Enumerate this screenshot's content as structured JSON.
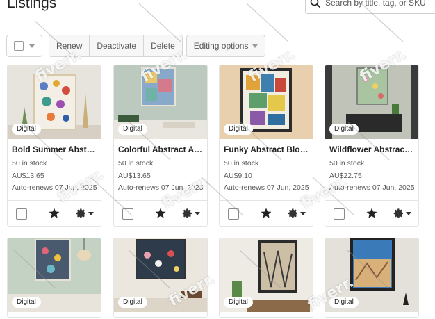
{
  "header": {
    "title": "Listings",
    "search_placeholder": "Search by title, tag, or SKU"
  },
  "toolbar": {
    "renew_label": "Renew",
    "deactivate_label": "Deactivate",
    "delete_label": "Delete",
    "editing_label": "Editing options"
  },
  "listings": [
    {
      "badge": "Digital",
      "title": "Bold Summer Abstract Art",
      "stock": "50 in stock",
      "price": "AU$13.65",
      "renews": "Auto-renews 07 Jun, 2025"
    },
    {
      "badge": "Digital",
      "title": "Colorful Abstract Art Print",
      "stock": "50 in stock",
      "price": "AU$13.65",
      "renews": "Auto-renews 07 Jun, 2025"
    },
    {
      "badge": "Digital",
      "title": "Funky Abstract Bloom Art",
      "stock": "50 in stock",
      "price": "AU$9.10",
      "renews": "Auto-renews 07 Jun, 2025"
    },
    {
      "badge": "Digital",
      "title": "Wildflower Abstract Painting",
      "stock": "50 in stock",
      "price": "AU$22.75",
      "renews": "Auto-renews 07 Jun, 2025"
    },
    {
      "badge": "Digital"
    },
    {
      "badge": "Digital"
    },
    {
      "badge": "Digital"
    },
    {
      "badge": "Digital"
    }
  ],
  "icons": {
    "search": "search-icon",
    "star": "star-icon",
    "gear": "gear-icon",
    "caret": "chevron-down-icon"
  },
  "watermark": "fiverr."
}
